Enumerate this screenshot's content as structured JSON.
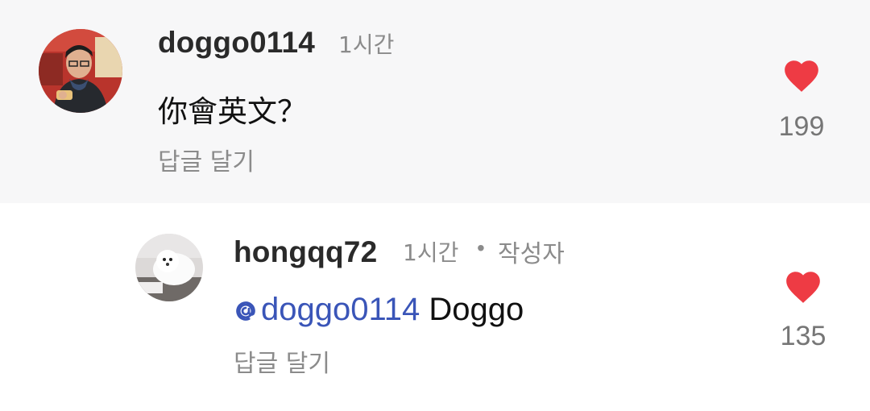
{
  "comments": [
    {
      "username": "doggo0114",
      "time": "1시간",
      "text": "你會英文？",
      "reply_label": "답글 달기",
      "likes": "199",
      "heart_color": "#ee3b44"
    },
    {
      "username": "hongqq72",
      "time": "1시간",
      "separator": "•",
      "author_badge": "작성자",
      "mention": "doggo0114",
      "text": "Doggo",
      "reply_label": "답글 달기",
      "likes": "135",
      "heart_color": "#ee3b44",
      "mention_color": "#3a55b8"
    }
  ]
}
